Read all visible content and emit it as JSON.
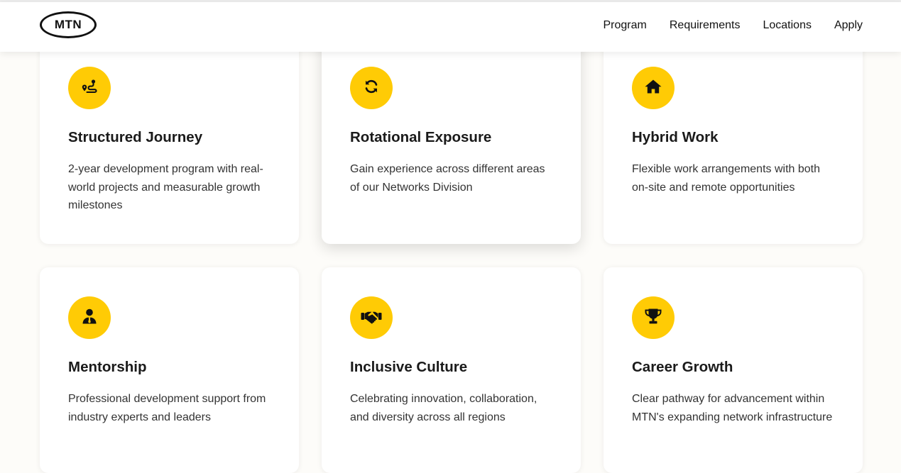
{
  "header": {
    "logo_text": "MTN",
    "nav": [
      {
        "label": "Program"
      },
      {
        "label": "Requirements"
      },
      {
        "label": "Locations"
      },
      {
        "label": "Apply"
      }
    ]
  },
  "colors": {
    "accent": "#ffcb05",
    "card_bg": "#ffffff",
    "page_bg": "#fdfcf9"
  },
  "cards": [
    {
      "icon": "route-icon",
      "title": "Structured Journey",
      "description": "2-year development program with real-world projects and measurable growth milestones"
    },
    {
      "icon": "rotate-icon",
      "title": "Rotational Exposure",
      "description": "Gain experience across different areas of our Networks Division"
    },
    {
      "icon": "home-icon",
      "title": "Hybrid Work",
      "description": "Flexible work arrangements with both on-site and remote opportunities"
    },
    {
      "icon": "mentor-icon",
      "title": "Mentorship",
      "description": "Professional development support from industry experts and leaders"
    },
    {
      "icon": "handshake-icon",
      "title": "Inclusive Culture",
      "description": "Celebrating innovation, collaboration, and diversity across all regions"
    },
    {
      "icon": "trophy-icon",
      "title": "Career Growth",
      "description": "Clear pathway for advancement within MTN's expanding network infrastructure"
    }
  ]
}
